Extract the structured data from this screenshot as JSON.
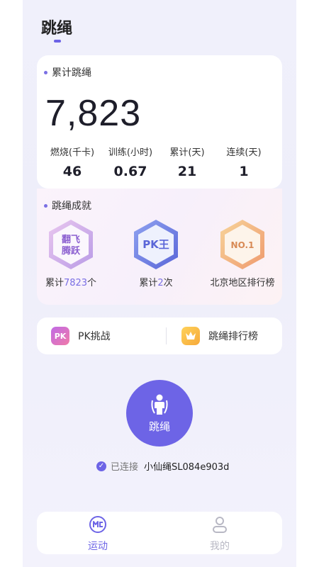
{
  "page": {
    "title": "跳绳"
  },
  "stats": {
    "section_label": "累计跳绳",
    "total": "7,823",
    "items": [
      {
        "label": "燃烧(千卡)",
        "value": "46"
      },
      {
        "label": "训练(小时)",
        "value": "0.67"
      },
      {
        "label": "累计(天)",
        "value": "21"
      },
      {
        "label": "连续(天)",
        "value": "1"
      }
    ]
  },
  "achievements": {
    "section_label": "跳绳成就",
    "badges": [
      {
        "icon": "fanfei-tengyue-badge-icon",
        "badge_text_1": "翻飞",
        "badge_text_2": "腾跃",
        "caption_prefix": "累计",
        "caption_value": "7823",
        "caption_suffix": "个"
      },
      {
        "icon": "pk-king-badge-icon",
        "badge_text": "PK王",
        "caption_prefix": "累计",
        "caption_value": "2",
        "caption_suffix": "次"
      },
      {
        "icon": "no1-badge-icon",
        "badge_text": "NO.1",
        "caption": "北京地区排行榜"
      }
    ]
  },
  "actions": {
    "pk": {
      "icon_text": "PK",
      "label": "PK挑战"
    },
    "rank": {
      "label": "跳绳排行榜"
    }
  },
  "jump_button": {
    "label": "跳绳"
  },
  "connection": {
    "status": "已连接",
    "device": "小仙绳SL084e903d"
  },
  "tabs": [
    {
      "label": "运动",
      "icon": "sport-icon",
      "active": true
    },
    {
      "label": "我的",
      "icon": "profile-icon",
      "active": false
    }
  ],
  "colors": {
    "accent": "#6d64e6",
    "inactive": "#b8b8c4"
  }
}
